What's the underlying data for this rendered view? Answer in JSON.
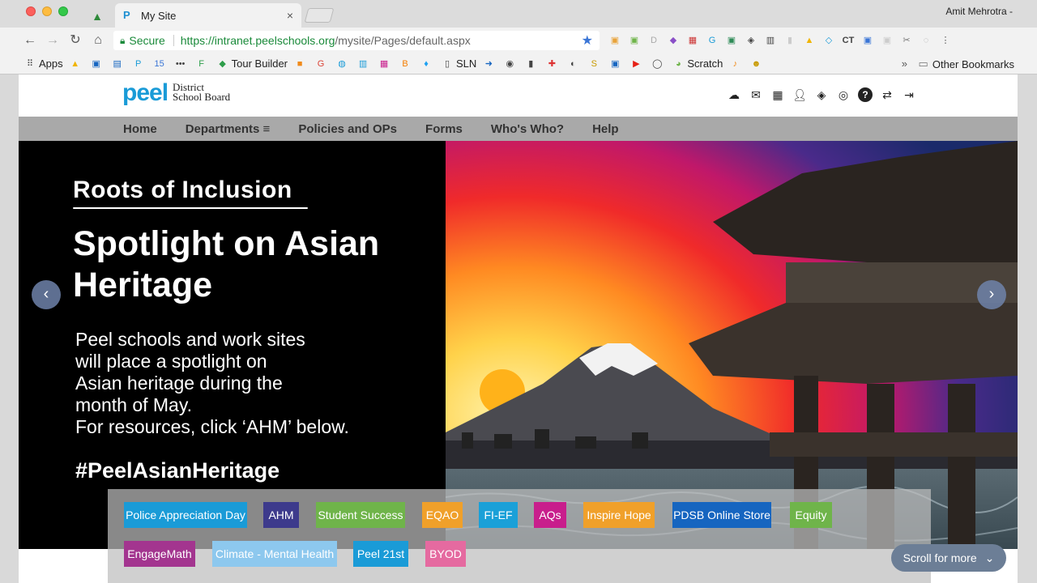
{
  "browser": {
    "tab_title": "My Site",
    "tab_close": "×",
    "user_name": "Amit Mehrotra -",
    "secure_label": "Secure",
    "url_host": "https://intranet.peelschools.org",
    "url_path": "/mysite/Pages/default.aspx",
    "bookmarks": [
      {
        "label": "Apps",
        "icon": "apps-grid-icon"
      },
      {
        "label": "",
        "icon": "google-drive-icon"
      },
      {
        "label": "",
        "icon": "contacts-icon"
      },
      {
        "label": "",
        "icon": "calendar-window-icon"
      },
      {
        "label": "",
        "icon": "peel-p-icon"
      },
      {
        "label": "",
        "icon": "calendar-15-icon"
      },
      {
        "label": "",
        "icon": "dots-icon"
      },
      {
        "label": "",
        "icon": "flip-icon"
      },
      {
        "label": "Tour Builder",
        "icon": "tour-builder-icon"
      },
      {
        "label": "",
        "icon": "orange-square-icon"
      },
      {
        "label": "",
        "icon": "google-g-icon"
      },
      {
        "label": "",
        "icon": "globe-icon"
      },
      {
        "label": "",
        "icon": "chart-icon"
      },
      {
        "label": "",
        "icon": "colored-square-icon"
      },
      {
        "label": "",
        "icon": "blogger-icon"
      },
      {
        "label": "",
        "icon": "twitter-icon"
      },
      {
        "label": "SLN",
        "icon": "document-icon"
      },
      {
        "label": "",
        "icon": "arrow-right-icon"
      },
      {
        "label": "",
        "icon": "circle-icon"
      },
      {
        "label": "",
        "icon": "book-icon"
      },
      {
        "label": "",
        "icon": "plus-icon"
      },
      {
        "label": "",
        "icon": "moon-icon"
      },
      {
        "label": "",
        "icon": "sp-icon"
      },
      {
        "label": "",
        "icon": "window-icon"
      },
      {
        "label": "",
        "icon": "youtube-icon"
      },
      {
        "label": "",
        "icon": "ring-icon"
      },
      {
        "label": "Scratch",
        "icon": "scratch-icon"
      },
      {
        "label": "",
        "icon": "music-icon"
      },
      {
        "label": "",
        "icon": "character-icon"
      }
    ],
    "other_bookmarks": "Other Bookmarks",
    "overflow": "»"
  },
  "site": {
    "logo_text": "peel",
    "logo_sub_1": "District",
    "logo_sub_2": "School Board",
    "nav": [
      "Home",
      "Departments ≡",
      "Policies and OPs",
      "Forms",
      "Who's Who?",
      "Help"
    ],
    "header_icons": [
      "cloud-icon",
      "mail-icon",
      "calendar-icon",
      "user-icon",
      "badge-icon",
      "search-icon",
      "help-icon",
      "swap-icon",
      "signout-icon"
    ]
  },
  "hero": {
    "kicker": "Roots of Inclusion",
    "title": "Spotlight on Asian Heritage",
    "body_lines": [
      "Peel schools and work sites",
      "will place a spotlight on",
      "Asian heritage during the",
      "month of May.",
      "For resources, click ‘AHM’ below."
    ],
    "hashtag": "#PeelAsianHeritage",
    "prev_symbol": "‹",
    "next_symbol": "›"
  },
  "quicklinks": [
    {
      "label": "Police Appreciation Day",
      "color": "#1a9bd7"
    },
    {
      "label": "AHM",
      "color": "#3d3a8c"
    },
    {
      "label": "Student Success",
      "color": "#6fb44a"
    },
    {
      "label": "EQAO",
      "color": "#f0a02a"
    },
    {
      "label": "FI-EF",
      "color": "#1aa0d8"
    },
    {
      "label": "AQs",
      "color": "#c81e8c"
    },
    {
      "label": "Inspire Hope",
      "color": "#f0a02a"
    },
    {
      "label": "PDSB Online Store",
      "color": "#1665c0"
    },
    {
      "label": "Equity",
      "color": "#6fb44a"
    },
    {
      "label": "EngageMath",
      "color": "#a3358f"
    },
    {
      "label": "Climate - Mental Health",
      "color": "#8dc8ee"
    },
    {
      "label": "Peel 21st",
      "color": "#1a9bd7"
    },
    {
      "label": "BYOD",
      "color": "#e56aa0"
    }
  ],
  "scroll_more": "Scroll for more"
}
